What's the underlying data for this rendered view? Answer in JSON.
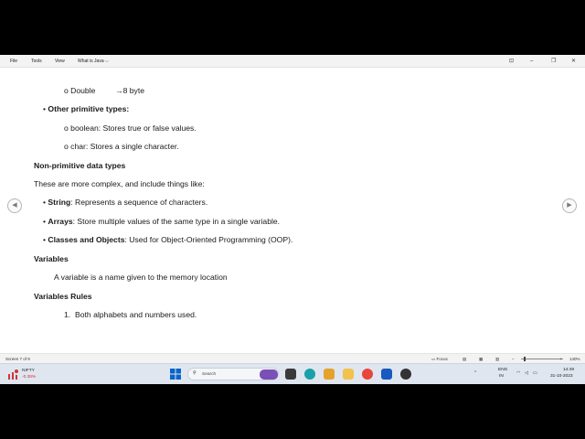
{
  "menu": {
    "file": "File",
    "tools": "Tools",
    "view": "View",
    "doc_title": "What is Java",
    "chevron": "⌵"
  },
  "window_controls": {
    "restore_alt": "⊡",
    "minimize": "–",
    "maximize": "❐",
    "close": "✕"
  },
  "document": {
    "lines": [
      "o Double",
      "→8 byte",
      "Other primitive types:",
      "o boolean: Stores true or false values.",
      "o char: Stores a single character.",
      "Non-primitive data types",
      "These are more complex, and include things like:",
      "String",
      ": Represents a sequence of characters.",
      "Arrays",
      ": Store multiple values of the same type in a single variable.",
      "Classes and Objects",
      ": Used for Object-Oriented Programming (OOP).",
      "Variables",
      "A variable is a name given to the memory location",
      "Variables Rules",
      "1.",
      "Both alphabets and numbers used."
    ],
    "bullet": "•"
  },
  "nav": {
    "prev": "◀",
    "next": "▶"
  },
  "status": {
    "screen": "Screen 7 of 9",
    "focus": "Focus",
    "zoom": "140%",
    "zoom_level": 0.14
  },
  "taskbar": {
    "stock_name": "NIFTY",
    "stock_change": "-0.38%",
    "search_placeholder": "Search",
    "lang1": "ENG",
    "lang2": "IN",
    "time": "14:49",
    "date": "31-10-2023"
  },
  "colors": {
    "accent": "#0a64c8",
    "stock_down": "#d13438",
    "taskbar_bg": "#dfe6ef"
  }
}
